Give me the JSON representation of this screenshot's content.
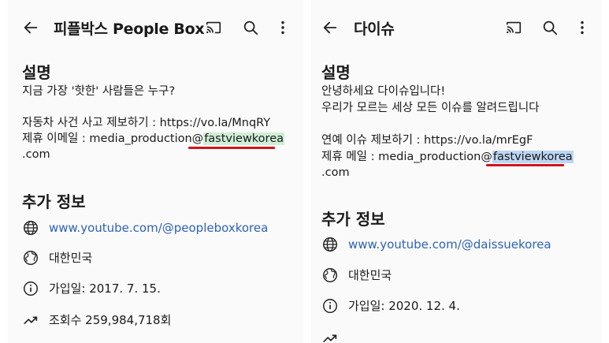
{
  "left": {
    "title": "피플박스 People Box",
    "section_description": "설명",
    "desc_line1": "지금 가장 '핫한' 사람들은 누구?",
    "desc_line2": "자동차 사건 사고 제보하기 : https://vo.la/MnqRY",
    "email_prefix": "제휴 이메일 : media_production@",
    "email_domain": "fastviewkorea",
    "email_suffix": ".com",
    "section_more": "추가 정보",
    "link": "www.youtube.com/@peopleboxkorea",
    "country": "대한민국",
    "joined": "가입일: 2017. 7. 15.",
    "views": "조회수 259,984,718회"
  },
  "right": {
    "title": "다이슈",
    "section_description": "설명",
    "desc_line1": "안녕하세요 다이슈입니다!",
    "desc_line2": "우리가 모르는 세상 모든 이슈를 알려드립니다",
    "desc_line3": "연예 이슈 제보하기 : https://vo.la/mrEgF",
    "email_prefix": "제휴 메일 : media_production@",
    "email_domain": "fastviewkorea",
    "email_suffix": ".com",
    "section_more": "추가 정보",
    "link": "www.youtube.com/@daissuekorea",
    "country": "대한민국",
    "joined": "가입일: 2020. 12. 4."
  },
  "icons": {
    "back": "arrow-left-icon",
    "cast": "cast-icon",
    "search": "search-icon",
    "more": "more-vert-icon",
    "globe": "globe-icon",
    "region": "region-globe-icon",
    "info": "info-icon",
    "trend": "trending-icon"
  },
  "colors": {
    "link": "#2f63b7",
    "underline": "#d0151b",
    "highlight_green": "#cfeed6",
    "highlight_blue": "#bcd6f3"
  }
}
